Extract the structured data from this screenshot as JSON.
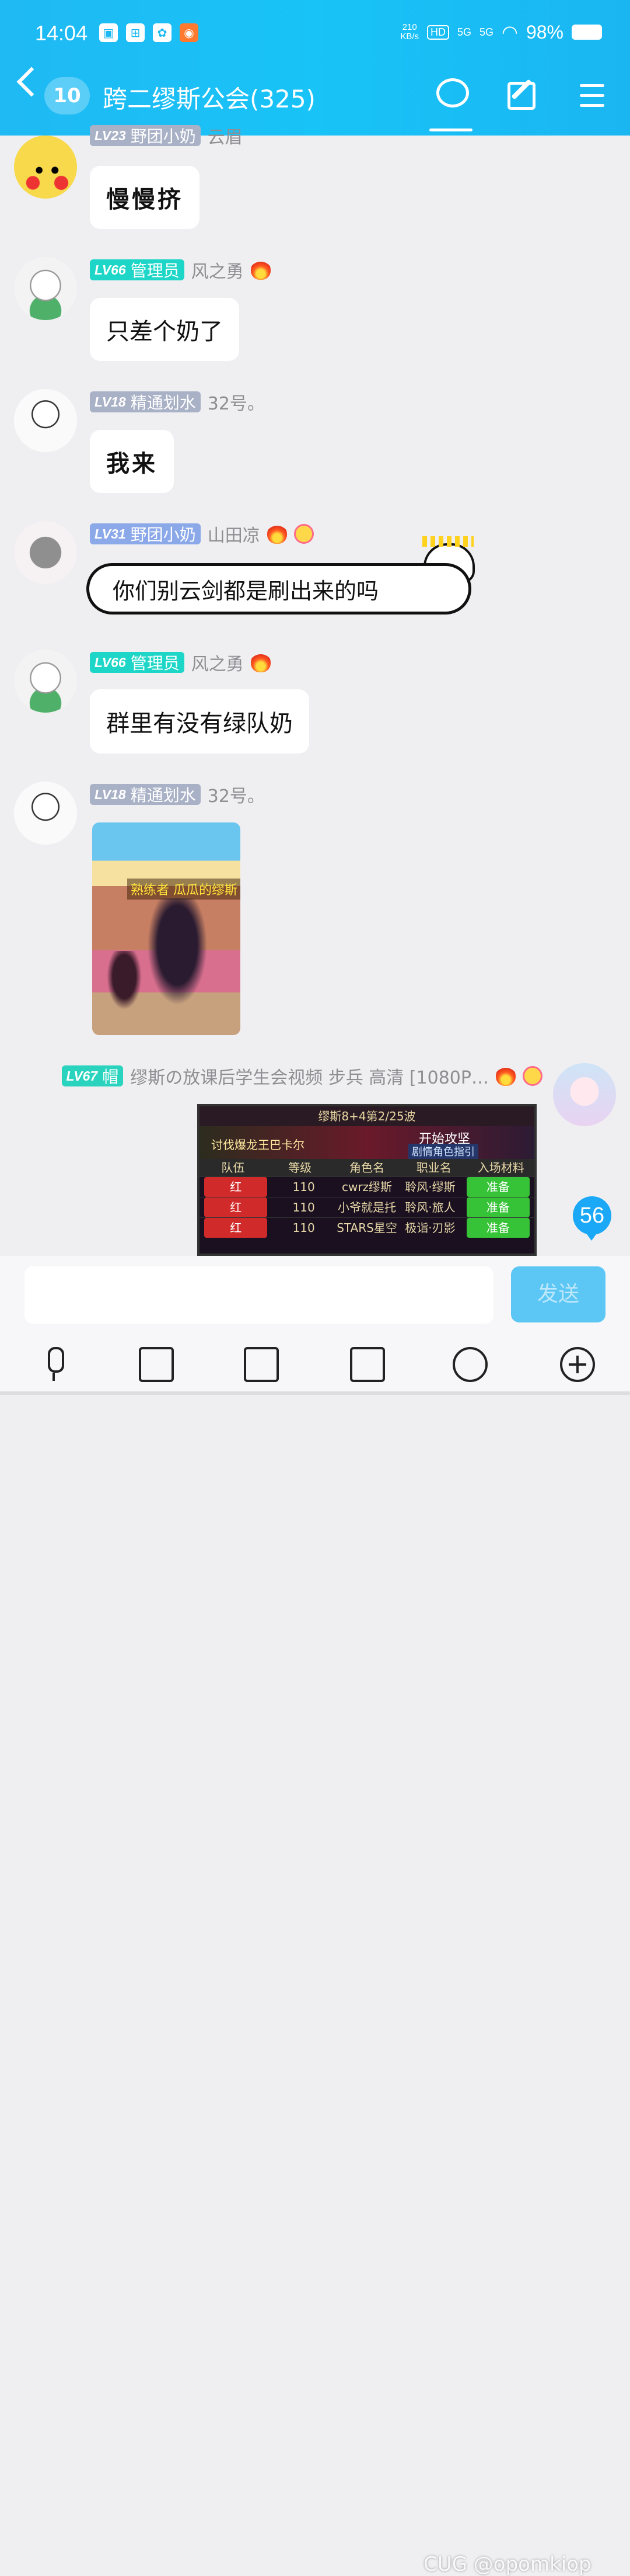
{
  "status": {
    "time": "14:04",
    "net_speed": "210",
    "net_unit": "KB/s",
    "hd": "HD",
    "sig1": "5G",
    "sig2": "5G",
    "battery": "98%"
  },
  "header": {
    "unread_count": "10",
    "title": "跨二缪斯公会(325)"
  },
  "messages": [
    {
      "level": "LV23",
      "title": "野团小奶",
      "nick": "云眉",
      "text": "慢慢挤"
    },
    {
      "level": "LV66",
      "title": "管理员",
      "nick": "风之勇",
      "text": "只差个奶了"
    },
    {
      "level": "LV18",
      "title": "精通划水",
      "nick": "32号。",
      "text": "我来"
    },
    {
      "level": "LV31",
      "title": "野团小奶",
      "nick": "山田凉",
      "text": "你们别云剑都是刷出来的吗"
    },
    {
      "level": "LV66",
      "title": "管理员",
      "nick": "风之勇",
      "text": "群里有没有绿队奶"
    },
    {
      "level": "LV18",
      "title": "精通划水",
      "nick": "32号。",
      "image_caption": "熟练者 瓜瓜的缪斯"
    },
    {
      "level": "LV67",
      "title": "帽",
      "nick": "缪斯の放课后学生会视频 步兵 高清 [1080P…"
    }
  ],
  "game_shot": {
    "title": "缪斯8+4第2/25波",
    "dungeon": "讨伐爆龙王巴卡尔",
    "start": "开始攻坚",
    "guide": "剧情角色指引",
    "columns": [
      "队伍",
      "等级",
      "角色名",
      "职业名",
      "入场材料"
    ],
    "rows": [
      {
        "team": "红",
        "level": "110",
        "name": "cwrz缪斯",
        "job": "聆风·缪斯",
        "status": "准备"
      },
      {
        "team": "红",
        "level": "110",
        "name": "小爷就是托",
        "job": "聆风·旅人",
        "status": "准备"
      },
      {
        "team": "红",
        "level": "110",
        "name": "STARS星空",
        "job": "极诣·刃影",
        "status": "准备"
      }
    ]
  },
  "floating_unread": "56",
  "composer": {
    "send_label": "发送",
    "input_value": ""
  },
  "watermark": "CUG @opomkiop",
  "colors": {
    "header": "#18c3f7",
    "badge_admin": "#1ed6c7",
    "send": "#5cc7f5"
  }
}
